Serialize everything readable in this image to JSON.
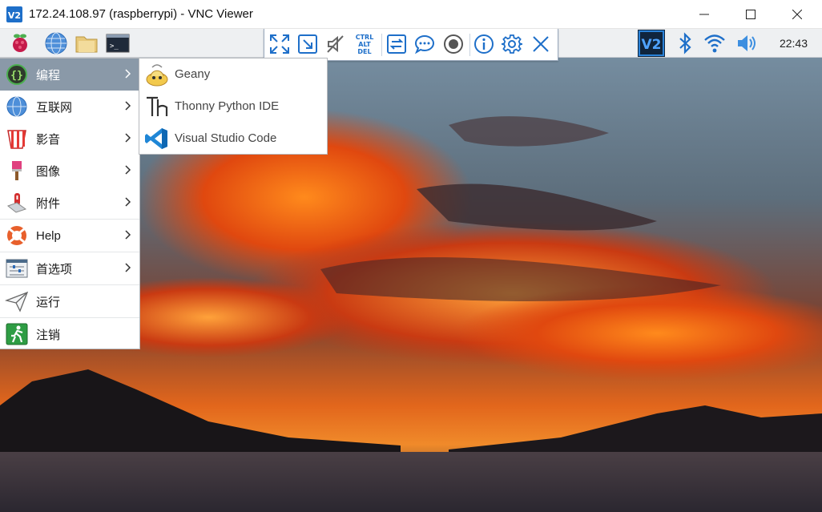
{
  "window": {
    "title": "172.24.108.97 (raspberrypi) - VNC Viewer",
    "app_icon": "vnc-logo-icon",
    "controls": [
      "minimize-icon",
      "maximize-icon",
      "close-icon"
    ]
  },
  "vnc_toolbar": {
    "buttons": [
      "fullscreen-icon",
      "scale-icon",
      "audio-muted-icon",
      "ctrl-alt-del-icon",
      "file-transfer-icon",
      "chat-icon",
      "record-icon",
      "info-icon",
      "settings-icon",
      "close-toolbar-icon"
    ],
    "ctrl_alt_del": [
      "CTRL",
      "ALT",
      "DEL"
    ],
    "accent": "#1e6fc9"
  },
  "panel": {
    "launchers": [
      "raspberry-menu-icon",
      "web-browser-icon",
      "file-manager-icon",
      "terminal-icon"
    ],
    "tray": [
      "vnc-server-icon",
      "bluetooth-icon",
      "wifi-icon",
      "volume-icon"
    ],
    "clock": "22:43"
  },
  "start_menu": {
    "items": [
      {
        "label": "编程",
        "icon": "programming-icon",
        "submenu": true,
        "active": true
      },
      {
        "label": "互联网",
        "icon": "internet-icon",
        "submenu": true
      },
      {
        "label": "影音",
        "icon": "sound-video-icon",
        "submenu": true
      },
      {
        "label": "图像",
        "icon": "graphics-icon",
        "submenu": true
      },
      {
        "label": "附件",
        "icon": "accessories-icon",
        "submenu": true
      },
      {
        "label": "Help",
        "icon": "help-icon",
        "submenu": true
      },
      {
        "label": "首选项",
        "icon": "preferences-icon",
        "submenu": true
      },
      {
        "label": "运行",
        "icon": "run-icon",
        "submenu": false
      },
      {
        "label": "注销",
        "icon": "logout-icon",
        "submenu": false
      }
    ],
    "active_color": "#8a99a8"
  },
  "submenu": {
    "items": [
      {
        "label": "Geany",
        "icon": "geany-icon"
      },
      {
        "label": "Thonny Python IDE",
        "icon": "thonny-icon"
      },
      {
        "label": "Visual Studio Code",
        "icon": "vscode-icon"
      }
    ]
  }
}
